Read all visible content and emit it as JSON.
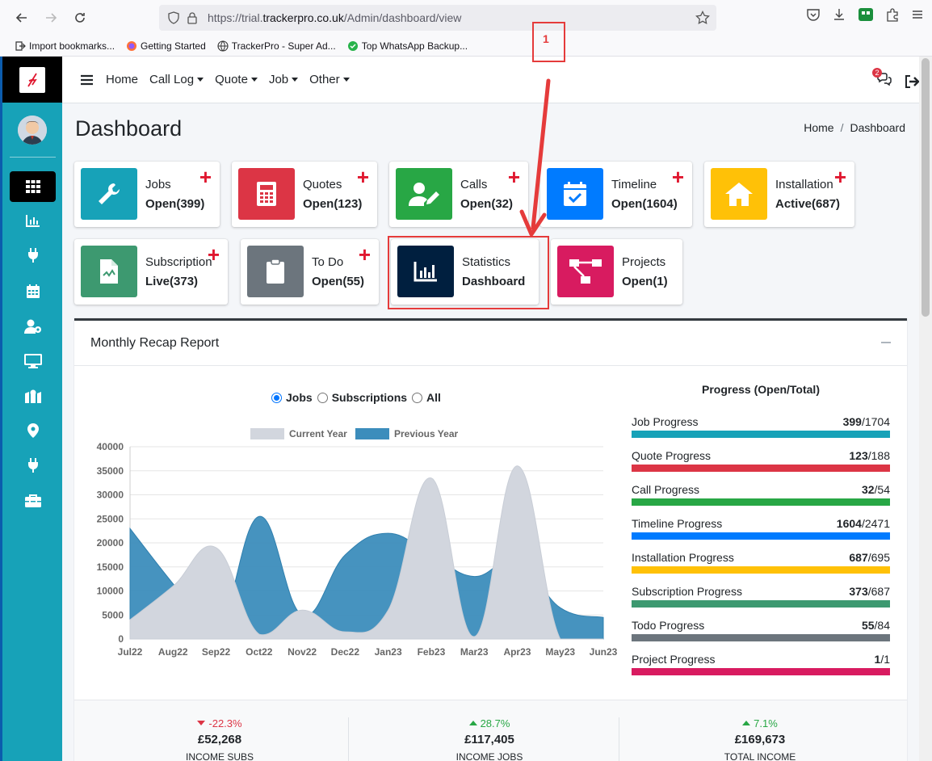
{
  "browser": {
    "url_prefix": "https://trial.",
    "url_domain": "trackerpro.co.uk",
    "url_path": "/Admin/dashboard/view",
    "bookmarks": [
      {
        "label": "Import bookmarks...",
        "icon": "import-icon"
      },
      {
        "label": "Getting Started",
        "icon": "firefox-icon"
      },
      {
        "label": "TrackerPro - Super Ad...",
        "icon": "globe-icon"
      },
      {
        "label": "Top WhatsApp Backup...",
        "icon": "whatsapp-icon"
      }
    ]
  },
  "annotation": {
    "number": "1",
    "color": "#e53b3b"
  },
  "nav": {
    "items": [
      {
        "label": "Home",
        "dropdown": false
      },
      {
        "label": "Call Log",
        "dropdown": true
      },
      {
        "label": "Quote",
        "dropdown": true
      },
      {
        "label": "Job",
        "dropdown": true
      },
      {
        "label": "Other",
        "dropdown": true
      }
    ],
    "notification_count": "2"
  },
  "header": {
    "title": "Dashboard",
    "breadcrumbs": [
      "Home",
      "Dashboard"
    ]
  },
  "boxes": [
    {
      "name": "jobs",
      "title": "Jobs",
      "value": "Open(399)",
      "color": "#17a2b8",
      "icon": "wrench-icon",
      "plus": true
    },
    {
      "name": "quotes",
      "title": "Quotes",
      "value": "Open(123)",
      "color": "#dc3545",
      "icon": "calculator-icon",
      "plus": true
    },
    {
      "name": "calls",
      "title": "Calls",
      "value": "Open(32)",
      "color": "#28a745",
      "icon": "user-edit-icon",
      "plus": true
    },
    {
      "name": "timeline",
      "title": "Timeline",
      "value": "Open(1604)",
      "color": "#007bff",
      "icon": "calendar-check-icon",
      "plus": true
    },
    {
      "name": "installation",
      "title": "Installation",
      "value": "Active(687)",
      "color": "#ffc107",
      "icon": "home-icon",
      "plus": true
    },
    {
      "name": "subscription",
      "title": "Subscription",
      "value": "Live(373)",
      "color": "#3d9970",
      "icon": "file-chart-icon",
      "plus": true
    },
    {
      "name": "todo",
      "title": "To Do",
      "value": "Open(55)",
      "color": "#6c757d",
      "icon": "clipboard-icon",
      "plus": true
    },
    {
      "name": "statistics",
      "title": "Statistics",
      "value": "Dashboard",
      "color": "#001f3f",
      "icon": "bar-chart-icon",
      "plus": false
    },
    {
      "name": "projects",
      "title": "Projects",
      "value": "Open(1)",
      "color": "#d81b60",
      "icon": "project-diagram-icon",
      "plus": false
    }
  ],
  "report": {
    "title": "Monthly Recap Report",
    "radio_options": [
      {
        "label": "Jobs",
        "checked": true
      },
      {
        "label": "Subscriptions",
        "checked": false
      },
      {
        "label": "All",
        "checked": false
      }
    ]
  },
  "chart_data": {
    "type": "area",
    "categories": [
      "Jul22",
      "Aug22",
      "Sep22",
      "Oct22",
      "Nov22",
      "Dec22",
      "Jan23",
      "Feb23",
      "Mar23",
      "Apr23",
      "May23",
      "Jun23"
    ],
    "series": [
      {
        "name": "Current Year",
        "color": "#d2d6de",
        "values": [
          4000,
          11000,
          19000,
          1000,
          6000,
          1500,
          6000,
          33500,
          500,
          36000,
          0,
          0
        ]
      },
      {
        "name": "Previous Year",
        "color": "#3c8dbc",
        "values": [
          23000,
          11500,
          1000,
          25500,
          5000,
          17500,
          22000,
          17500,
          13000,
          16500,
          6500,
          4500
        ]
      }
    ],
    "yticks": [
      0,
      5000,
      10000,
      15000,
      20000,
      25000,
      30000,
      35000,
      40000
    ],
    "ylim": [
      0,
      40000
    ],
    "legend": "top",
    "grid": true
  },
  "progress": {
    "title": "Progress (Open/Total)",
    "items": [
      {
        "label": "Job Progress",
        "open": "399",
        "total": "/1704",
        "color": "#17a2b8"
      },
      {
        "label": "Quote Progress",
        "open": "123",
        "total": "/188",
        "color": "#dc3545"
      },
      {
        "label": "Call Progress",
        "open": "32",
        "total": "/54",
        "color": "#28a745"
      },
      {
        "label": "Timeline Progress",
        "open": "1604",
        "total": "/2471",
        "color": "#007bff"
      },
      {
        "label": "Installation Progress",
        "open": "687",
        "total": "/695",
        "color": "#ffc107"
      },
      {
        "label": "Subscription Progress",
        "open": "373",
        "total": "/687",
        "color": "#3d9970"
      },
      {
        "label": "Todo Progress",
        "open": "55",
        "total": "/84",
        "color": "#6c757d"
      },
      {
        "label": "Project Progress",
        "open": "1",
        "total": "/1",
        "color": "#d81b60"
      }
    ]
  },
  "stats": [
    {
      "pct": "-22.3%",
      "direction": "down",
      "amount": "£52,268",
      "label": "INCOME SUBS"
    },
    {
      "pct": "28.7%",
      "direction": "up",
      "amount": "£117,405",
      "label": "INCOME JOBS"
    },
    {
      "pct": "7.1%",
      "direction": "up",
      "amount": "£169,673",
      "label": "TOTAL INCOME"
    }
  ]
}
